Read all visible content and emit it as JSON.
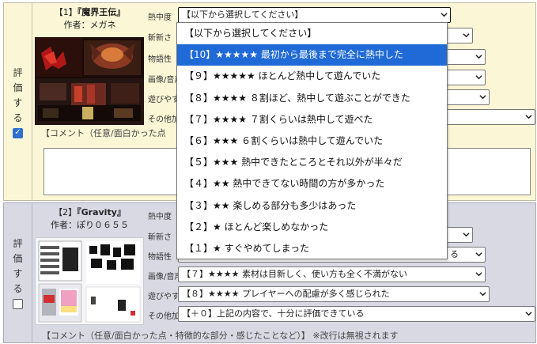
{
  "entries": [
    {
      "eval_label": [
        "評",
        "価",
        "す",
        "る"
      ],
      "checked": true,
      "number": "【1】",
      "title": "『魔界王伝』",
      "author": "作者：メガネ",
      "rows": [
        {
          "label": "熱中度",
          "value": "【以下から選択してください】"
        },
        {
          "label": "斬新さ",
          "value": ""
        },
        {
          "label": "物語性",
          "value": ""
        },
        {
          "label": "画像/音声",
          "value": ""
        },
        {
          "label": "遊びやすさ",
          "value": ""
        },
        {
          "label": "その他加点",
          "value": ""
        }
      ],
      "comment_label": "【コメント（任意/面白かった点"
    },
    {
      "eval_label": [
        "評",
        "価",
        "す",
        "る"
      ],
      "checked": false,
      "number": "【2】",
      "title": "『Gravity』",
      "author": "作者：ぽり０６５５",
      "rows": [
        {
          "label": "熱中度",
          "value": ""
        },
        {
          "label": "斬新さ",
          "value": ""
        },
        {
          "label": "物語性",
          "value": "る"
        },
        {
          "label": "画像/音声",
          "value": "【７】★★★★ 素材は目新しく、使い方も全く不満がない"
        },
        {
          "label": "遊びやすさ",
          "value": "【８】★★★★ プレイヤーへの配慮が多く感じられた"
        },
        {
          "label": "その他加点",
          "value": "【＋０】上記の内容で、十分に評価できている"
        }
      ],
      "comment_label": "【コメント（任意/面白かった点・特徴的な部分・感じたことなど）】 ※改行は無視されます"
    }
  ],
  "dropdown": {
    "options": [
      "【以下から選択してください】",
      "【10】★★★★★ 最初から最後まで完全に熱中した",
      "【９】★★★★★ ほとんど熱中して遊んでいた",
      "【８】★★★★ ８割ほど、熱中して遊ぶことができた",
      "【７】★★★★ ７割くらいは熱中して遊べた",
      "【６】★★★ ６割くらいは熱中して遊んでいた",
      "【５】★★★ 熱中できたところとそれ以外が半々だ",
      "【４】★★ 熱中できてない時間の方が多かった",
      "【３】★★ 楽しめる部分も多少はあった",
      "【２】★ ほとんど楽しめなかった",
      "【１】★ すぐやめてしまった"
    ],
    "selected_index": 1
  },
  "colors": {
    "entry1_bg": "#fbf7d6",
    "entry2_bg": "#d9d9e4",
    "highlight": "#1f6ad6"
  }
}
